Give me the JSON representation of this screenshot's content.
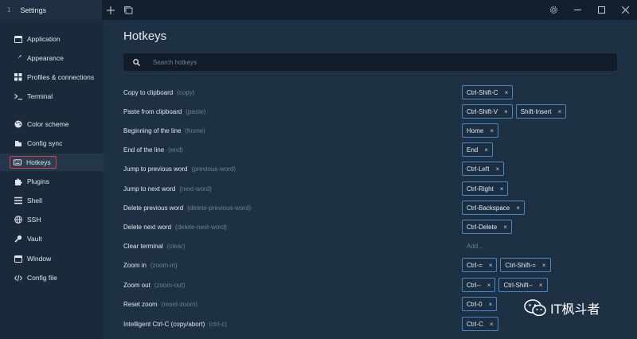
{
  "titlebar": {
    "tab_number": "1",
    "tab_title": "Settings"
  },
  "sidebar": {
    "items": [
      {
        "label": "Application",
        "icon": "window-icon"
      },
      {
        "label": "Appearance",
        "icon": "brush-icon"
      },
      {
        "label": "Profiles & connections",
        "icon": "profiles-icon"
      },
      {
        "label": "Terminal",
        "icon": "terminal-icon"
      },
      {
        "label": "Color scheme",
        "icon": "palette-icon"
      },
      {
        "label": "Config sync",
        "icon": "sync-icon"
      },
      {
        "label": "Hotkeys",
        "icon": "keyboard-icon"
      },
      {
        "label": "Plugins",
        "icon": "puzzle-icon"
      },
      {
        "label": "Shell",
        "icon": "list-icon"
      },
      {
        "label": "SSH",
        "icon": "globe-icon"
      },
      {
        "label": "Vault",
        "icon": "key-icon"
      },
      {
        "label": "Window",
        "icon": "window-icon"
      },
      {
        "label": "Config file",
        "icon": "code-icon"
      }
    ]
  },
  "main": {
    "title": "Hotkeys",
    "search_placeholder": "Search hotkeys",
    "rows": [
      {
        "name": "Copy to clipboard",
        "id": "(copy)",
        "keys": [
          "Ctrl-Shift-C"
        ]
      },
      {
        "name": "Paste from clipboard",
        "id": "(paste)",
        "keys": [
          "Ctrl-Shift-V",
          "Shift-Insert"
        ]
      },
      {
        "name": "Beginning of the line",
        "id": "(home)",
        "keys": [
          "Home"
        ]
      },
      {
        "name": "End of the line",
        "id": "(end)",
        "keys": [
          "End"
        ]
      },
      {
        "name": "Jump to previous word",
        "id": "(previous-word)",
        "keys": [
          "Ctrl-Left"
        ]
      },
      {
        "name": "Jump to next word",
        "id": "(next-word)",
        "keys": [
          "Ctrl-Right"
        ]
      },
      {
        "name": "Delete previous word",
        "id": "(delete-previous-word)",
        "keys": [
          "Ctrl-Backspace"
        ]
      },
      {
        "name": "Delete next word",
        "id": "(delete-next-word)",
        "keys": [
          "Ctrl-Delete"
        ]
      },
      {
        "name": "Clear terminal",
        "id": "(clear)",
        "keys": [],
        "add_label": "Add..."
      },
      {
        "name": "Zoom in",
        "id": "(zoom-in)",
        "keys": [
          "Ctrl-=",
          "Ctrl-Shift-="
        ]
      },
      {
        "name": "Zoom out",
        "id": "(zoom-out)",
        "keys": [
          "Ctrl--",
          "Ctrl-Shift--"
        ]
      },
      {
        "name": "Reset zoom",
        "id": "(reset-zoom)",
        "keys": [
          "Ctrl-0"
        ]
      },
      {
        "name": "Intelligent Ctrl-C (copy/abort)",
        "id": "(ctrl-c)",
        "keys": [
          "Ctrl-C"
        ]
      }
    ],
    "remove_glyph": "×"
  },
  "watermark": {
    "text": "IT枫斗者",
    "icon": "wechat-icon"
  },
  "colors": {
    "accent": "#4a88c4",
    "highlight": "#e23b3b",
    "background": "#1e3044"
  }
}
